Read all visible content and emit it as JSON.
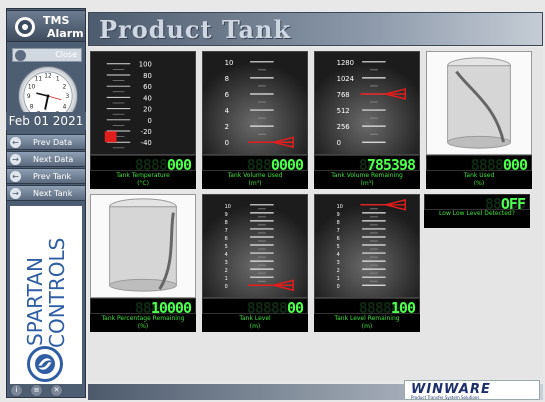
{
  "app": {
    "title": "Product Tank",
    "tms_line1": "TMS",
    "tms_line2": "Alarm",
    "user_close": "Close",
    "date": "Feb 01 2021"
  },
  "nav": {
    "buttons": [
      "Prev Data",
      "Next Data",
      "Prev Tank",
      "Next Tank"
    ]
  },
  "brand": {
    "line1": "SPARTAN",
    "line2": "CONTROLS",
    "winware": "WINWARE",
    "winware_sub": "Product Transfer System Solutions"
  },
  "gauges": {
    "temperature": {
      "caption1": "Tank Temperature",
      "caption2": "(°C)",
      "value": "000",
      "ghost": "8888888",
      "scale": [
        "100",
        "80",
        "60",
        "40",
        "20",
        "0",
        "-20",
        "-40"
      ],
      "fill_fraction": 0.14
    },
    "volume_used": {
      "caption1": "Tank Volume Used",
      "caption2": "(m³)",
      "value": "0000",
      "ghost": "8888888",
      "scale": [
        "10",
        "8",
        "6",
        "4",
        "2",
        "0"
      ],
      "pointer_value": 0
    },
    "volume_remaining": {
      "caption1": "Tank Volume Remaining",
      "caption2": "(m³)",
      "value": "785398",
      "ghost": "8888888",
      "scale": [
        "1280",
        "1024",
        "768",
        "512",
        "256",
        "0"
      ],
      "pointer_value": 768
    },
    "tank_used": {
      "caption1": "Tank Used",
      "caption2": "(%)",
      "value": "000",
      "ghost": "8888888"
    },
    "percentage_remaining": {
      "caption1": "Tank Percentage Remaining",
      "caption2": "(%)",
      "value": "10000",
      "ghost": "8888888"
    },
    "tank_level": {
      "caption1": "Tank Level",
      "caption2": "(m)",
      "value": "00",
      "ghost": "8888888",
      "scale": [
        "10",
        "9",
        "8",
        "7",
        "6",
        "5",
        "4",
        "3",
        "2",
        "1",
        "0"
      ],
      "pointer_value": 0
    },
    "level_remaining": {
      "caption1": "Tank Level Remaining",
      "caption2": "(m)",
      "value": "100",
      "ghost": "8888888",
      "scale": [
        "10",
        "9",
        "8",
        "7",
        "6",
        "5",
        "4",
        "3",
        "2",
        "1",
        "0"
      ],
      "pointer_value": 10
    },
    "lowlow": {
      "value": "OFF",
      "ghost": "88888",
      "caption": "Low Low Level Detected?"
    }
  },
  "colors": {
    "lcd_green": "#4dff4d",
    "pointer_red": "#e11d1d",
    "sidebar": "#4e5e72"
  }
}
